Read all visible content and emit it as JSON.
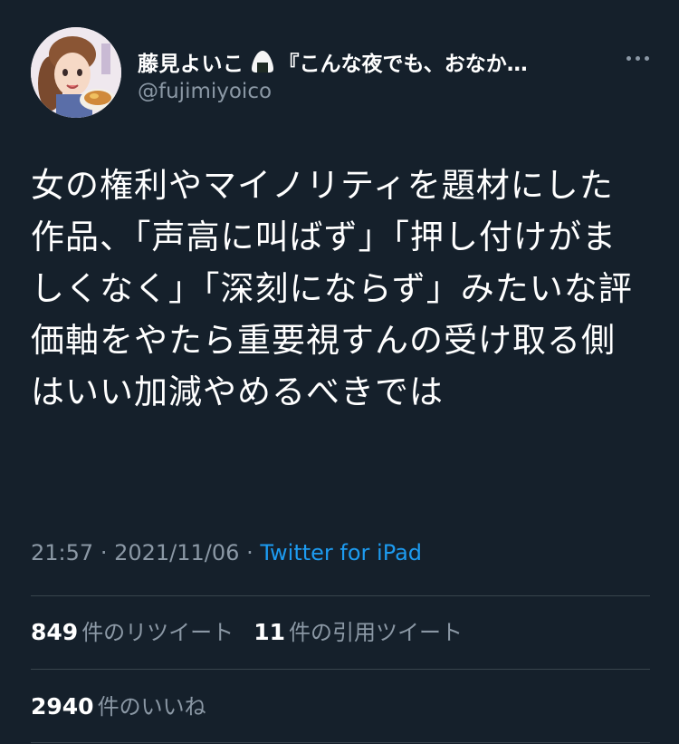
{
  "author": {
    "display_name": "藤見よいこ",
    "name_suffix": "『こんな夜でも、おなか…",
    "handle": "@fujimiyoico"
  },
  "tweet": {
    "text": "女の権利やマイノリティを題材にした作品、「声高に叫ばず」「押し付けがましくなく」「深刻にならず」みたいな評価軸をやたら重要視すんの受け取る側はいい加減やめるべきでは",
    "time": "21:57",
    "separator": "·",
    "date": "2021/11/06",
    "source": "Twitter for iPad"
  },
  "stats": {
    "retweets_count": "849",
    "retweets_label": "件のリツイート",
    "quotes_count": "11",
    "quotes_label": "件の引用ツイート",
    "likes_count": "2940",
    "likes_label": "件のいいね"
  },
  "colors": {
    "background": "#15202b",
    "secondary_text": "#8b98a5",
    "link": "#1d9bf0",
    "divider": "#38444d"
  },
  "icons": {
    "avatar": "avatar",
    "name_emoji": "onigiri-icon",
    "more": "more-icon"
  }
}
